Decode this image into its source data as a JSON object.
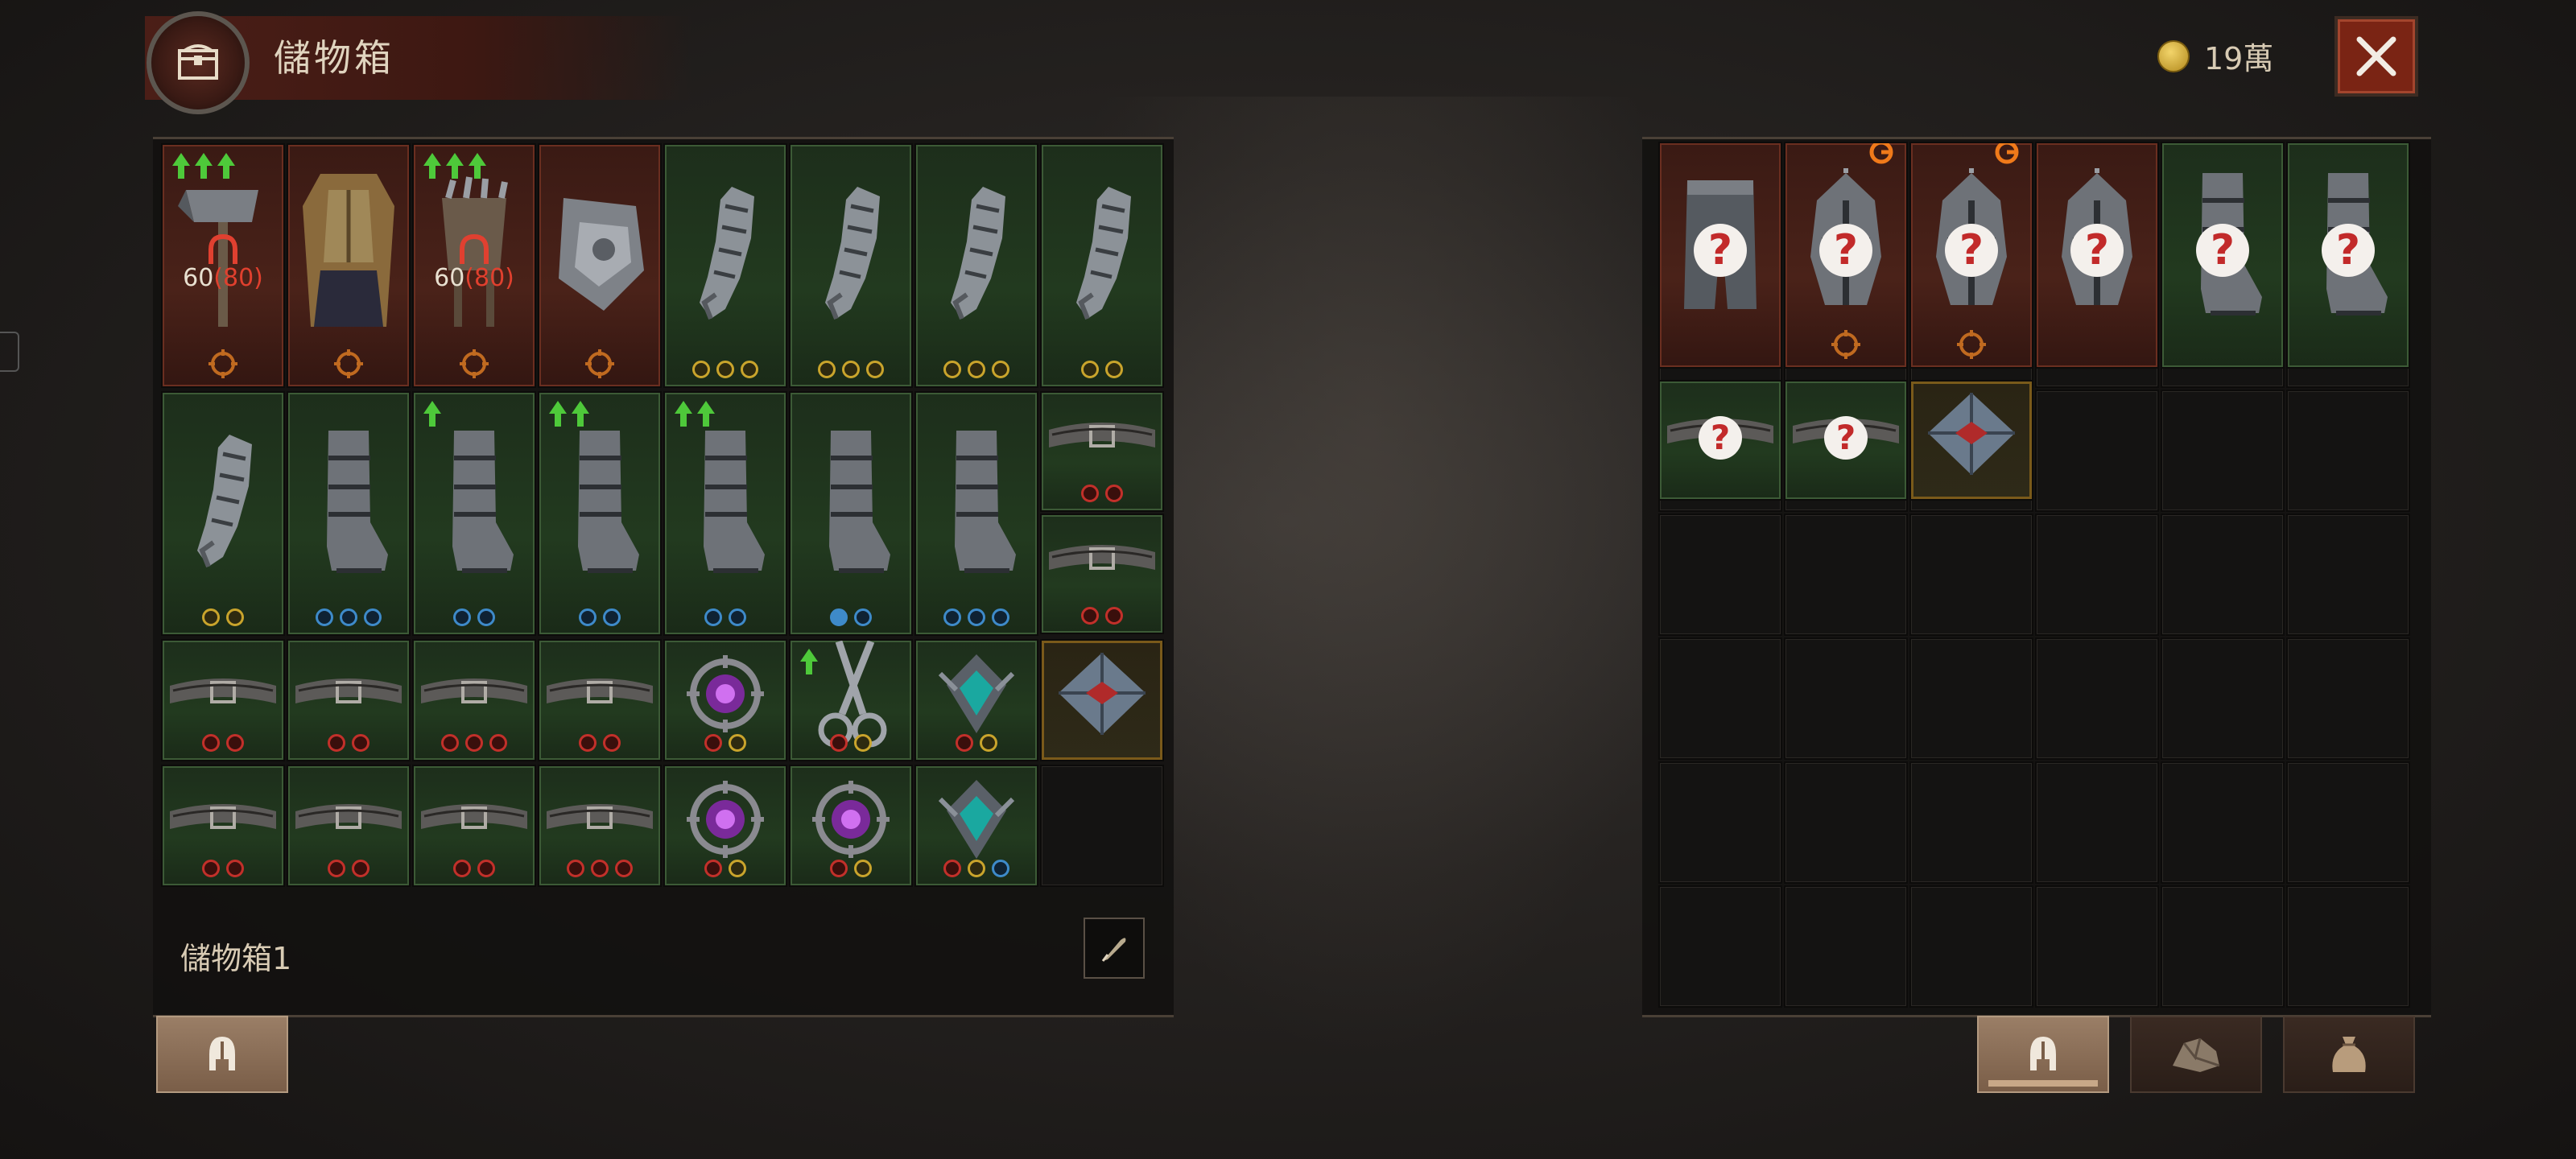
{
  "header": {
    "title": "儲物箱",
    "currency": "19萬",
    "close_icon": "close-icon"
  },
  "left_panel": {
    "stash_name": "儲物箱1",
    "overlay_level": "60",
    "overlay_level_req": "(80)",
    "rows": [
      [
        "weapon-hammer",
        "chest-armor",
        "weapon-fist",
        "shoulder-guard",
        "gauntlet",
        "gauntlet",
        "gauntlet",
        "gauntlet"
      ],
      [
        "gauntlet",
        "boots",
        "boots",
        "boots",
        "boots",
        "boots",
        "boots",
        "belt/belt"
      ],
      [
        "belt",
        "belt",
        "belt",
        "belt",
        "amulet",
        "weapon-scissors",
        "gem-pendant",
        "gem-crystal"
      ],
      [
        "belt",
        "belt",
        "belt",
        "belt",
        "amulet",
        "amulet",
        "gem-pendant",
        "empty"
      ]
    ]
  },
  "right_panel": {
    "unknown_marker": "?",
    "slots_row1": [
      "pants",
      "helmet",
      "helmet",
      "helmet",
      "boots",
      "boots"
    ],
    "slots_row2": [
      "belt",
      "belt",
      "gem-crystal"
    ]
  },
  "tabs_left": [
    "helmet-icon"
  ],
  "tabs_right": [
    "helmet-icon",
    "rock-icon",
    "bag-icon"
  ],
  "colors": {
    "legendary": "#6a2e20",
    "set": "#3c5a36",
    "rare": "#7a5a1a",
    "accent": "#7a2414"
  }
}
